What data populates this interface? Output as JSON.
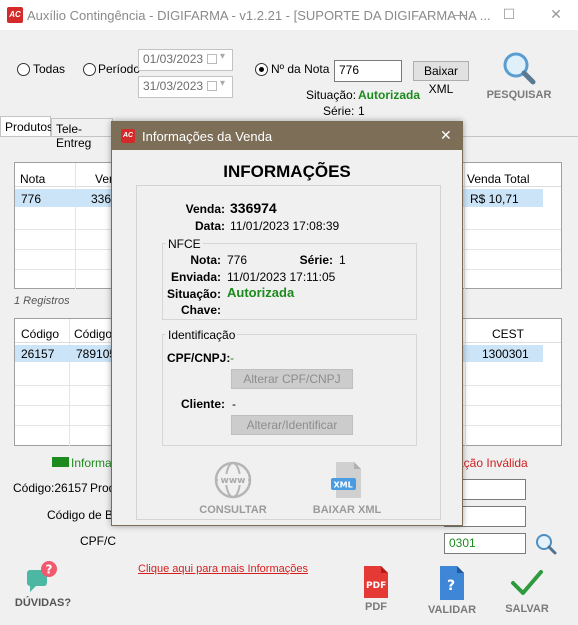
{
  "window": {
    "title": "Auxílio Contingência - DIGIFARMA - v1.2.21 - [SUPORTE DA DIGIFARMA NA ...",
    "icon": "AC",
    "minimize": "—",
    "maximize": "☐",
    "close": "✕"
  },
  "filters": {
    "todas_label": "Todas",
    "periodo_label": "Período",
    "date_from": "01/03/2023",
    "date_to": "31/03/2023",
    "nota_label": "Nº da Nota",
    "nota_value": "776",
    "baixar_xml_label": "Baixar XML",
    "situacao_label": "Situação:",
    "situacao_value": "Autorizada",
    "serie_label": "Série:",
    "serie_value": "1",
    "pesquisar_label": "PESQUISAR"
  },
  "tabs": [
    "Produtos",
    "Tele-Entreg"
  ],
  "sales_grid": {
    "headers": [
      "Nota",
      "Ven",
      "Venda Total"
    ],
    "row": [
      "776",
      "3369",
      "R$ 10,71"
    ],
    "count": "1 Registros"
  },
  "products_grid": {
    "headers": [
      "Código",
      "Código d",
      "CEST"
    ],
    "row": [
      "26157",
      "789105",
      "1300301"
    ]
  },
  "status_legend": {
    "left": "Informa",
    "right": "ação Inválida"
  },
  "bottom_fields": {
    "codigo_line": "Código:26157",
    "produto_label": "Prod",
    "codigo_barras_label": "Código de Ba",
    "cpf_label": "CPF/C",
    "cpf_partial_value": "0301",
    "more_info_link": "Clique aqui para mais Informações"
  },
  "bottom_buttons": {
    "duvidas": "DÚVIDAS?",
    "pdf": "PDF",
    "validar": "VALIDAR",
    "salvar": "SALVAR"
  },
  "modal": {
    "title": "Informações da Venda",
    "heading": "INFORMAÇÕES",
    "venda_label": "Venda:",
    "venda_value": "336974",
    "data_label": "Data:",
    "data_value": "11/01/2023 17:08:39",
    "nfce_title": "NFCE",
    "nota_label": "Nota:",
    "nota_value": "776",
    "serie_label": "Série:",
    "serie_value": "1",
    "enviada_label": "Enviada:",
    "enviada_value": "11/01/2023 17:11:05",
    "situacao_label": "Situação:",
    "situacao_value": "Autorizada",
    "chave_label": "Chave:",
    "chave_value": "",
    "ident_title": "Identificação",
    "cpf_label": "CPF/CNPJ:",
    "cpf_value": "-",
    "alterar_cpf_label": "Alterar CPF/CNPJ",
    "cliente_label": "Cliente:",
    "cliente_value": "-",
    "alterar_ident_label": "Alterar/Identificar",
    "consultar_label": "CONSULTAR",
    "baixar_xml_label": "BAIXAR XML",
    "www_text": "www",
    "xml_text": "XML"
  },
  "colors": {
    "green": "#1d8a1d",
    "red": "#d41f1f",
    "modal_title_bg": "#7c6e57",
    "selected_row": "#cce4f7"
  }
}
